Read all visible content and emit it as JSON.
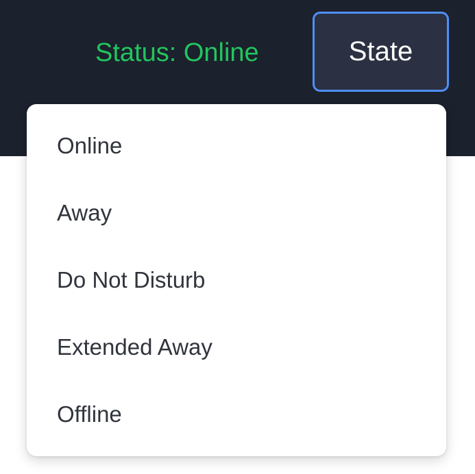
{
  "header": {
    "status_text": "Status: Online",
    "state_button_label": "State"
  },
  "dropdown": {
    "items": [
      {
        "label": "Online"
      },
      {
        "label": "Away"
      },
      {
        "label": "Do Not Disturb"
      },
      {
        "label": "Extended Away"
      },
      {
        "label": "Offline"
      }
    ]
  },
  "colors": {
    "header_background": "#1b212d",
    "status_online": "#22c55e",
    "button_background": "#2b3142",
    "button_focus_border": "#4f8ff7",
    "menu_text": "#30343c"
  }
}
